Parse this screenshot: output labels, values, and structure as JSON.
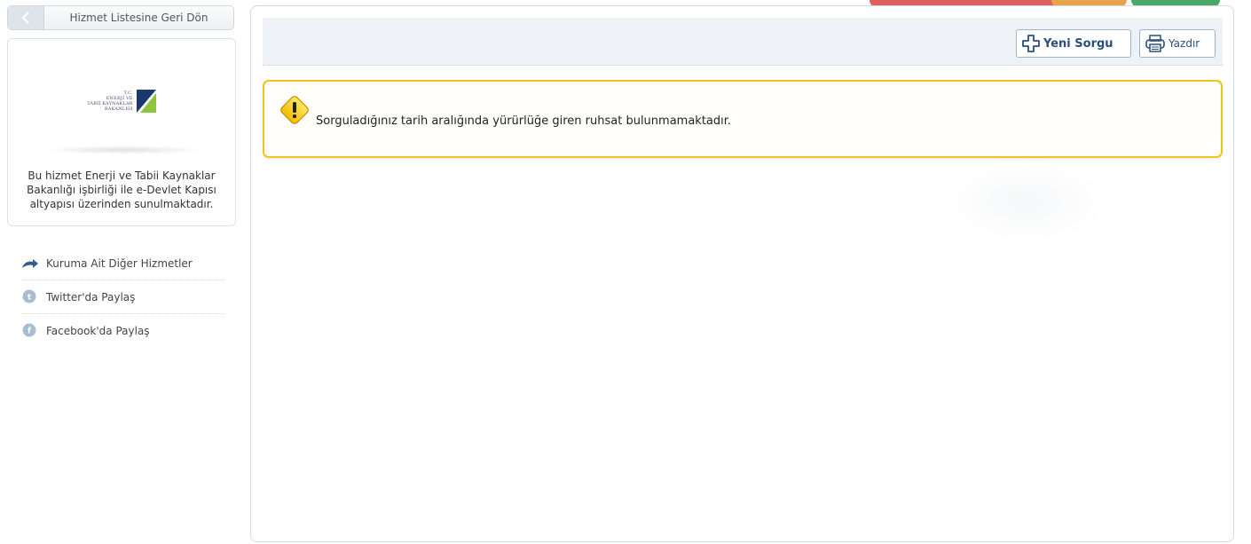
{
  "sidebar": {
    "back_button_label": "Hizmet Listesine Geri Dön",
    "logo_lines": [
      "T.C.",
      "ENERJİ VE",
      "TABİİ KAYNAKLAR",
      "BAKANLIĞI"
    ],
    "info_text": "Bu hizmet Enerji ve Tabii Kaynaklar Bakanlığı işbirliği ile e-Devlet Kapısı altyapısı üzerinden sunulmaktadır.",
    "links": [
      {
        "label": "Kuruma Ait Diğer Hizmetler",
        "icon": "share-arrow-icon"
      },
      {
        "label": "Twitter'da Paylaş",
        "icon": "twitter-icon"
      },
      {
        "label": "Facebook'da Paylaş",
        "icon": "facebook-icon"
      }
    ]
  },
  "toolbar": {
    "new_query_label": "Yeni Sorgu",
    "print_label": "Yazdır"
  },
  "alert": {
    "message": "Sorguladığınız tarih aralığında yürürlüğe giren ruhsat bulunmamaktadır."
  },
  "colors": {
    "alert_border": "#f0c419",
    "button_text": "#2b4f7c",
    "logo_blue": "#1a3a6b",
    "logo_green": "#8cc63f"
  }
}
